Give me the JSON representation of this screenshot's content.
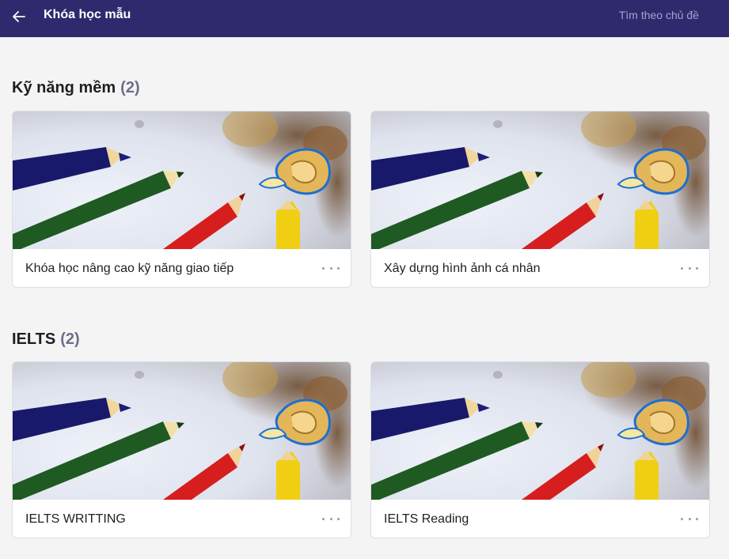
{
  "header": {
    "title": "Khóa học mẫu",
    "search_placeholder": "Tìm theo chủ đề"
  },
  "sections": [
    {
      "title": "Kỹ năng mềm",
      "count": "(2)",
      "courses": [
        {
          "title": "Khóa học nâng cao kỹ năng giao tiếp"
        },
        {
          "title": "Xây dựng hình ảnh cá nhân"
        }
      ]
    },
    {
      "title": "IELTS",
      "count": "(2)",
      "courses": [
        {
          "title": "IELTS WRITTING"
        },
        {
          "title": "IELTS Reading"
        }
      ]
    }
  ],
  "colors": {
    "header_bg": "#2f2a6e",
    "page_bg": "#f4f4f5"
  },
  "icons": {
    "back": "arrow-left-icon",
    "more": "more-horizontal-icon"
  }
}
